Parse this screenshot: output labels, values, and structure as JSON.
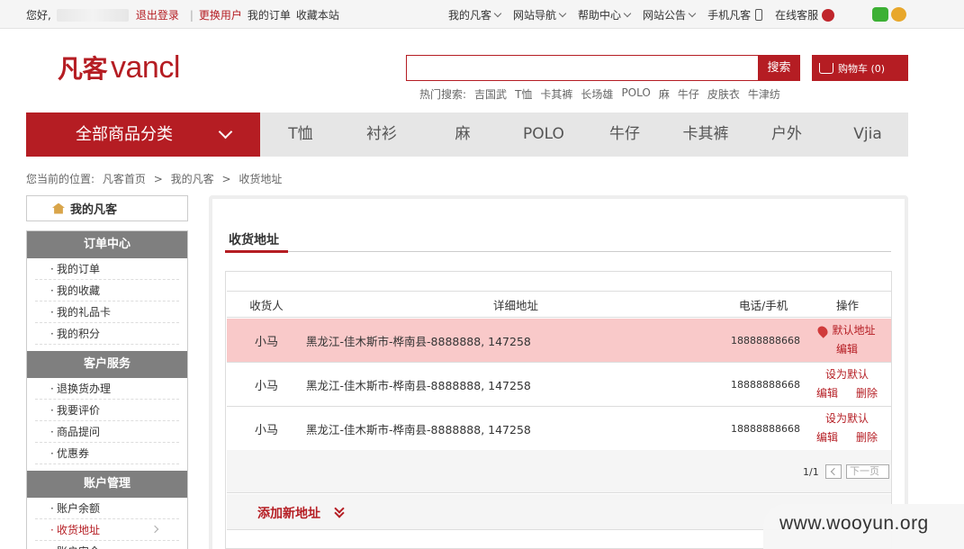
{
  "topbar": {
    "greeting": "您好,",
    "logout": "退出登录",
    "switch_user": "更换用户",
    "my_orders": "我的订单",
    "bookmark": "收藏本站",
    "right": [
      "我的凡客",
      "网站导航",
      "帮助中心",
      "网站公告"
    ],
    "mobile": "手机凡客",
    "service": "在线客服"
  },
  "header": {
    "logo_cn": "凡客",
    "logo_en": "vancl",
    "search_button": "搜索",
    "cart": "购物车 (0)",
    "hot_label": "热门搜索:",
    "hot": [
      "吉国武",
      "T恤",
      "卡其裤",
      "长场雄",
      "POLO",
      "麻",
      "牛仔",
      "皮肤衣",
      "牛津纺"
    ]
  },
  "nav": {
    "all": "全部商品分类",
    "items": [
      "T恤",
      "衬衫",
      "麻",
      "POLO",
      "牛仔",
      "卡其裤",
      "户外",
      "Vjia"
    ]
  },
  "breadcrumb": [
    "您当前的位置:",
    "凡客首页",
    ">",
    "我的凡客",
    ">",
    "收货地址"
  ],
  "sidebar": {
    "my": "我的凡客",
    "groups": [
      {
        "title": "订单中心",
        "items": [
          "我的订单",
          "我的收藏",
          "我的礼品卡",
          "我的积分"
        ]
      },
      {
        "title": "客户服务",
        "items": [
          "退换货办理",
          "我要评价",
          "商品提问",
          "优惠券"
        ]
      },
      {
        "title": "账户管理",
        "items": [
          "账户余额",
          "收货地址",
          "账户安全"
        ]
      }
    ]
  },
  "main": {
    "title": "收货地址",
    "headers": [
      "收货人",
      "详细地址",
      "电话/手机",
      "操作"
    ],
    "rows": [
      {
        "name": "小马",
        "address": "黑龙江-佳木斯市-桦南县-8888888, 147258",
        "phone": "18888888668",
        "op1": "默认地址",
        "op2": "编辑",
        "op3": ""
      },
      {
        "name": "小马",
        "address": "黑龙江-佳木斯市-桦南县-8888888, 147258",
        "phone": "18888888668",
        "op1": "设为默认",
        "op2": "编辑",
        "op3": "删除"
      },
      {
        "name": "小马",
        "address": "黑龙江-佳木斯市-桦南县-8888888, 147258",
        "phone": "18888888668",
        "op1": "设为默认",
        "op2": "编辑",
        "op3": "删除"
      }
    ],
    "page": "1/1",
    "next": "下一页",
    "add": "添加新地址"
  },
  "watermark": "www.wooyun.org"
}
